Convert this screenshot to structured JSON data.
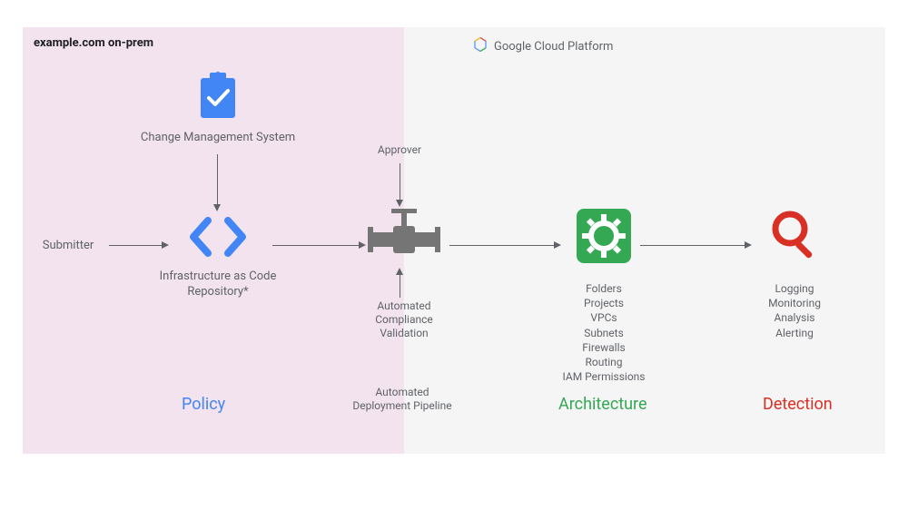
{
  "header": {
    "onprem": "example.com on-prem",
    "gcp": "Google Cloud Platform"
  },
  "nodes": {
    "submitter": "Submitter",
    "cms": "Change Management System",
    "iac": "Infrastructure as Code Repository*",
    "approver": "Approver",
    "compliance": "Automated Compliance Validation",
    "pipeline": "Automated Deployment Pipeline",
    "gear_items": {
      "a": "Folders",
      "b": "Projects",
      "c": "VPCs",
      "d": "Subnets",
      "e": "Firewalls",
      "f": "Routing",
      "g": "IAM Permissions"
    },
    "mag_items": {
      "a": "Logging",
      "b": "Monitoring",
      "c": "Analysis",
      "d": "Alerting"
    }
  },
  "sections": {
    "policy": "Policy",
    "architecture": "Architecture",
    "detection": "Detection"
  },
  "colors": {
    "blue": "#4285f4",
    "green": "#34a853",
    "red": "#d93025",
    "grey": "#5f6368"
  }
}
